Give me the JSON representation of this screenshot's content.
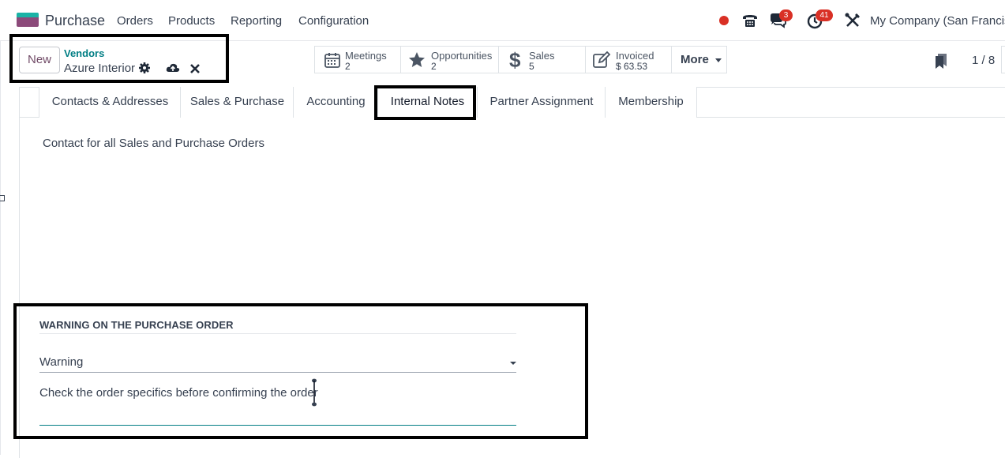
{
  "navbar": {
    "app_name": "Purchase",
    "menus": [
      "Orders",
      "Products",
      "Reporting",
      "Configuration"
    ],
    "messages_badge": "3",
    "activities_badge": "41",
    "company": "My Company (San Francisco)"
  },
  "control_panel": {
    "new_label": "New",
    "breadcrumb": "Vendors",
    "record_name": "Azure Interior",
    "smart_buttons": [
      {
        "label": "Meetings",
        "value": "2",
        "icon": "calendar-icon"
      },
      {
        "label": "Opportunities",
        "value": "2",
        "icon": "star-icon"
      },
      {
        "label": "Sales",
        "value": "5",
        "icon": "dollar-icon"
      },
      {
        "label": "Invoiced",
        "value": "$ 63.53",
        "icon": "invoice-edit-icon"
      }
    ],
    "more_label": "More",
    "pager": "1 / 8"
  },
  "tabs": [
    "Contacts & Addresses",
    "Sales & Purchase",
    "Accounting",
    "Internal Notes",
    "Partner Assignment",
    "Membership"
  ],
  "active_tab": "Internal Notes",
  "internal_notes": {
    "text": "Contact for all Sales and Purchase Orders"
  },
  "warning_section": {
    "title": "WARNING ON THE PURCHASE ORDER",
    "warning_type": "Warning",
    "message": "Check the order specifics before confirming the order"
  },
  "colors": {
    "brand": "#714b67",
    "link": "#017e84",
    "badge": "#d93025"
  }
}
